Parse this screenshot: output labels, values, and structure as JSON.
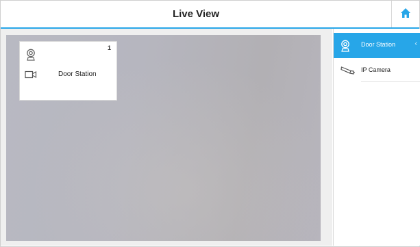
{
  "header": {
    "title": "Live View",
    "home_icon": "home-icon"
  },
  "tile": {
    "number": "1",
    "label": "Door Station"
  },
  "sidebar": {
    "items": [
      {
        "label": "Door Station",
        "icon": "door-station-icon",
        "active": true
      },
      {
        "label": "IP Camera",
        "icon": "ip-camera-icon",
        "active": false
      }
    ],
    "chevron": "‹"
  },
  "colors": {
    "accent": "#27a6e8"
  }
}
